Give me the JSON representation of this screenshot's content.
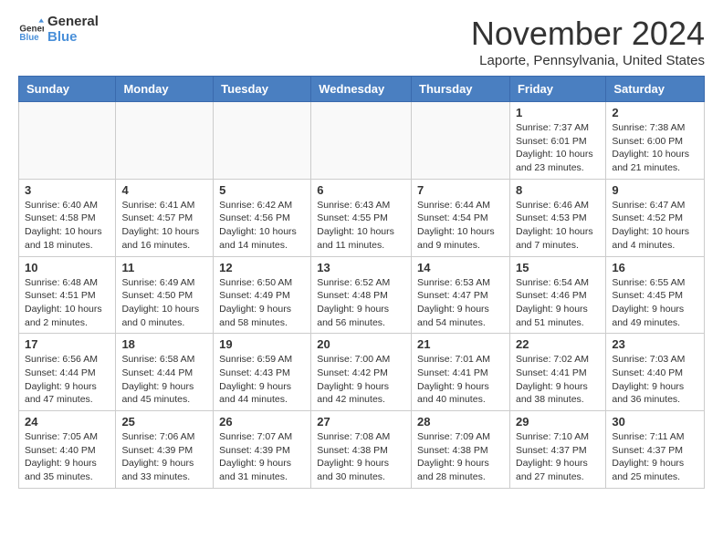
{
  "logo": {
    "line1": "General",
    "line2": "Blue"
  },
  "title": "November 2024",
  "location": "Laporte, Pennsylvania, United States",
  "days_of_week": [
    "Sunday",
    "Monday",
    "Tuesday",
    "Wednesday",
    "Thursday",
    "Friday",
    "Saturday"
  ],
  "weeks": [
    [
      {
        "day": "",
        "info": ""
      },
      {
        "day": "",
        "info": ""
      },
      {
        "day": "",
        "info": ""
      },
      {
        "day": "",
        "info": ""
      },
      {
        "day": "",
        "info": ""
      },
      {
        "day": "1",
        "info": "Sunrise: 7:37 AM\nSunset: 6:01 PM\nDaylight: 10 hours and 23 minutes."
      },
      {
        "day": "2",
        "info": "Sunrise: 7:38 AM\nSunset: 6:00 PM\nDaylight: 10 hours and 21 minutes."
      }
    ],
    [
      {
        "day": "3",
        "info": "Sunrise: 6:40 AM\nSunset: 4:58 PM\nDaylight: 10 hours and 18 minutes."
      },
      {
        "day": "4",
        "info": "Sunrise: 6:41 AM\nSunset: 4:57 PM\nDaylight: 10 hours and 16 minutes."
      },
      {
        "day": "5",
        "info": "Sunrise: 6:42 AM\nSunset: 4:56 PM\nDaylight: 10 hours and 14 minutes."
      },
      {
        "day": "6",
        "info": "Sunrise: 6:43 AM\nSunset: 4:55 PM\nDaylight: 10 hours and 11 minutes."
      },
      {
        "day": "7",
        "info": "Sunrise: 6:44 AM\nSunset: 4:54 PM\nDaylight: 10 hours and 9 minutes."
      },
      {
        "day": "8",
        "info": "Sunrise: 6:46 AM\nSunset: 4:53 PM\nDaylight: 10 hours and 7 minutes."
      },
      {
        "day": "9",
        "info": "Sunrise: 6:47 AM\nSunset: 4:52 PM\nDaylight: 10 hours and 4 minutes."
      }
    ],
    [
      {
        "day": "10",
        "info": "Sunrise: 6:48 AM\nSunset: 4:51 PM\nDaylight: 10 hours and 2 minutes."
      },
      {
        "day": "11",
        "info": "Sunrise: 6:49 AM\nSunset: 4:50 PM\nDaylight: 10 hours and 0 minutes."
      },
      {
        "day": "12",
        "info": "Sunrise: 6:50 AM\nSunset: 4:49 PM\nDaylight: 9 hours and 58 minutes."
      },
      {
        "day": "13",
        "info": "Sunrise: 6:52 AM\nSunset: 4:48 PM\nDaylight: 9 hours and 56 minutes."
      },
      {
        "day": "14",
        "info": "Sunrise: 6:53 AM\nSunset: 4:47 PM\nDaylight: 9 hours and 54 minutes."
      },
      {
        "day": "15",
        "info": "Sunrise: 6:54 AM\nSunset: 4:46 PM\nDaylight: 9 hours and 51 minutes."
      },
      {
        "day": "16",
        "info": "Sunrise: 6:55 AM\nSunset: 4:45 PM\nDaylight: 9 hours and 49 minutes."
      }
    ],
    [
      {
        "day": "17",
        "info": "Sunrise: 6:56 AM\nSunset: 4:44 PM\nDaylight: 9 hours and 47 minutes."
      },
      {
        "day": "18",
        "info": "Sunrise: 6:58 AM\nSunset: 4:44 PM\nDaylight: 9 hours and 45 minutes."
      },
      {
        "day": "19",
        "info": "Sunrise: 6:59 AM\nSunset: 4:43 PM\nDaylight: 9 hours and 44 minutes."
      },
      {
        "day": "20",
        "info": "Sunrise: 7:00 AM\nSunset: 4:42 PM\nDaylight: 9 hours and 42 minutes."
      },
      {
        "day": "21",
        "info": "Sunrise: 7:01 AM\nSunset: 4:41 PM\nDaylight: 9 hours and 40 minutes."
      },
      {
        "day": "22",
        "info": "Sunrise: 7:02 AM\nSunset: 4:41 PM\nDaylight: 9 hours and 38 minutes."
      },
      {
        "day": "23",
        "info": "Sunrise: 7:03 AM\nSunset: 4:40 PM\nDaylight: 9 hours and 36 minutes."
      }
    ],
    [
      {
        "day": "24",
        "info": "Sunrise: 7:05 AM\nSunset: 4:40 PM\nDaylight: 9 hours and 35 minutes."
      },
      {
        "day": "25",
        "info": "Sunrise: 7:06 AM\nSunset: 4:39 PM\nDaylight: 9 hours and 33 minutes."
      },
      {
        "day": "26",
        "info": "Sunrise: 7:07 AM\nSunset: 4:39 PM\nDaylight: 9 hours and 31 minutes."
      },
      {
        "day": "27",
        "info": "Sunrise: 7:08 AM\nSunset: 4:38 PM\nDaylight: 9 hours and 30 minutes."
      },
      {
        "day": "28",
        "info": "Sunrise: 7:09 AM\nSunset: 4:38 PM\nDaylight: 9 hours and 28 minutes."
      },
      {
        "day": "29",
        "info": "Sunrise: 7:10 AM\nSunset: 4:37 PM\nDaylight: 9 hours and 27 minutes."
      },
      {
        "day": "30",
        "info": "Sunrise: 7:11 AM\nSunset: 4:37 PM\nDaylight: 9 hours and 25 minutes."
      }
    ]
  ]
}
